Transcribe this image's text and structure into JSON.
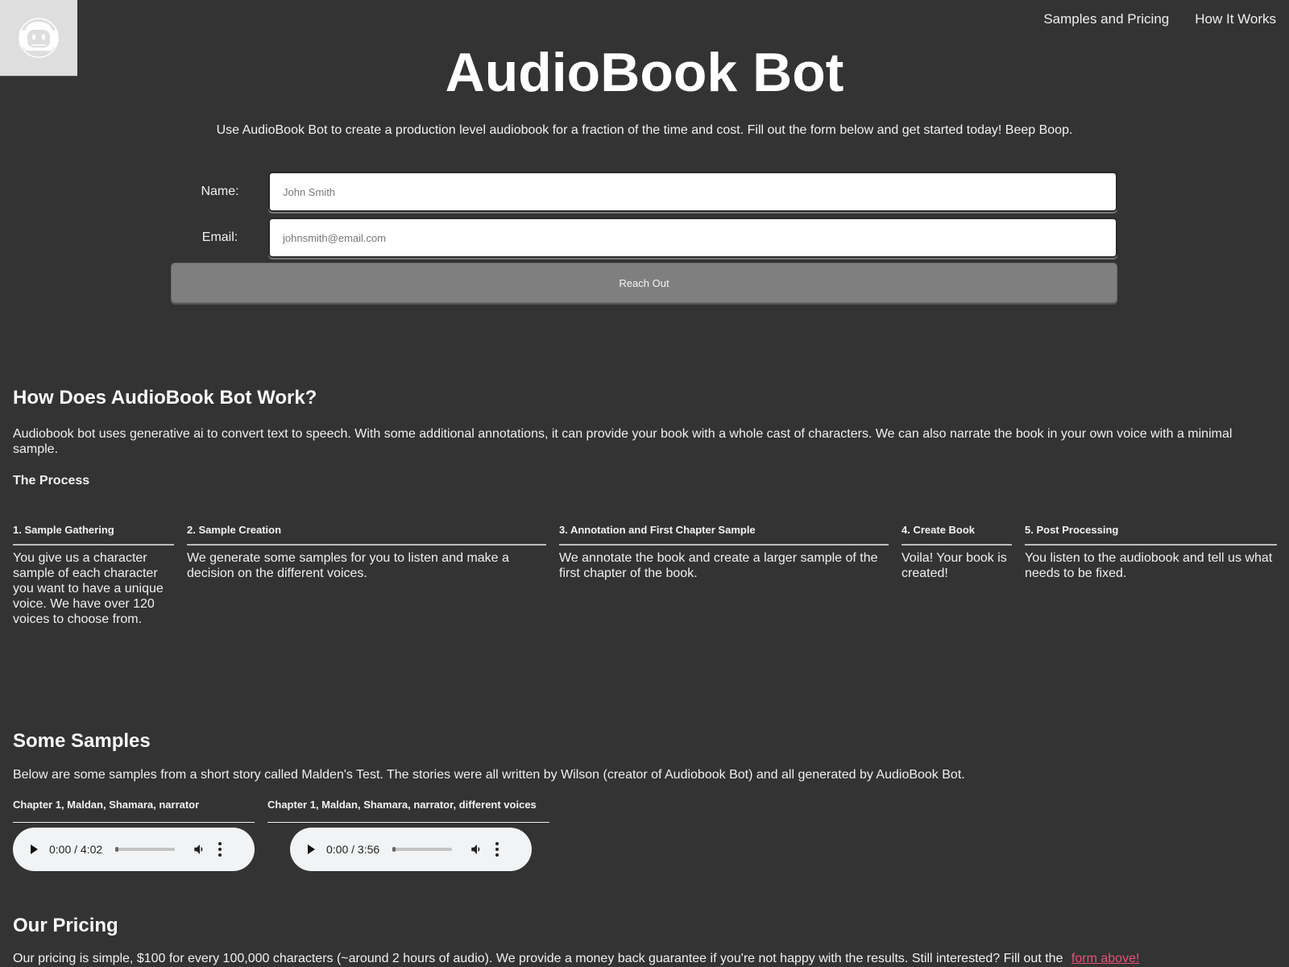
{
  "header": {
    "logo_icon": "robot-headphones-icon",
    "nav": [
      {
        "label": "Samples and Pricing"
      },
      {
        "label": "How It Works"
      }
    ]
  },
  "hero": {
    "title": "AudioBook Bot",
    "subtitle": "Use AudioBook Bot to create a production level audiobook for a fraction of the time and cost. Fill out the form below and get started today! Beep Boop."
  },
  "form": {
    "name_label": "Name:",
    "name_placeholder": "John Smith",
    "name_value": "",
    "email_label": "Email:",
    "email_placeholder": "johnsmith@email.com",
    "email_value": "",
    "submit_label": "Reach Out"
  },
  "how": {
    "title": "How Does AudioBook Bot Work?",
    "description": "Audiobook bot uses generative ai to convert text to speech. With some additional annotations, it can provide your book with a whole cast of characters. We can also narrate the book in your own voice with a minimal sample.",
    "process_title": "The Process",
    "steps": [
      {
        "title": "1. Sample Gathering",
        "text": "You give us a character sample of each character you want to have a unique voice. We have over 120 voices to choose from."
      },
      {
        "title": "2. Sample Creation",
        "text": "We generate some samples for you to listen and make a decision on the different voices."
      },
      {
        "title": "3. Annotation and First Chapter Sample",
        "text": "We annotate the book and create a larger sample of the first chapter of the book."
      },
      {
        "title": "4. Create Book",
        "text": "Voila! Your book is created!"
      },
      {
        "title": "5. Post Processing",
        "text": "You listen to the audiobook and tell us what needs to be fixed."
      }
    ]
  },
  "samples": {
    "title": "Some Samples",
    "description": "Below are some samples from a short story called Malden's Test. The stories were all written by Wilson (creator of Audiobook Bot) and all generated by AudioBook Bot.",
    "items": [
      {
        "title": "Chapter 1, Maldan, Shamara, narrator",
        "time": "0:00 / 4:02",
        "progress": 0
      },
      {
        "title": "Chapter 1, Maldan, Shamara, narrator, different voices",
        "time": "0:00 / 3:56",
        "progress": 0
      }
    ]
  },
  "pricing": {
    "title": "Our Pricing",
    "text": "Our pricing is simple, $100 for every 100,000 characters (~around 2 hours of audio). We provide a money back guarantee if you're not happy with the results. Still interested? Fill out the",
    "link_label": "form above!"
  },
  "colors": {
    "background": "#333333",
    "link": "#e8507a",
    "button": "#7f7f7f"
  }
}
